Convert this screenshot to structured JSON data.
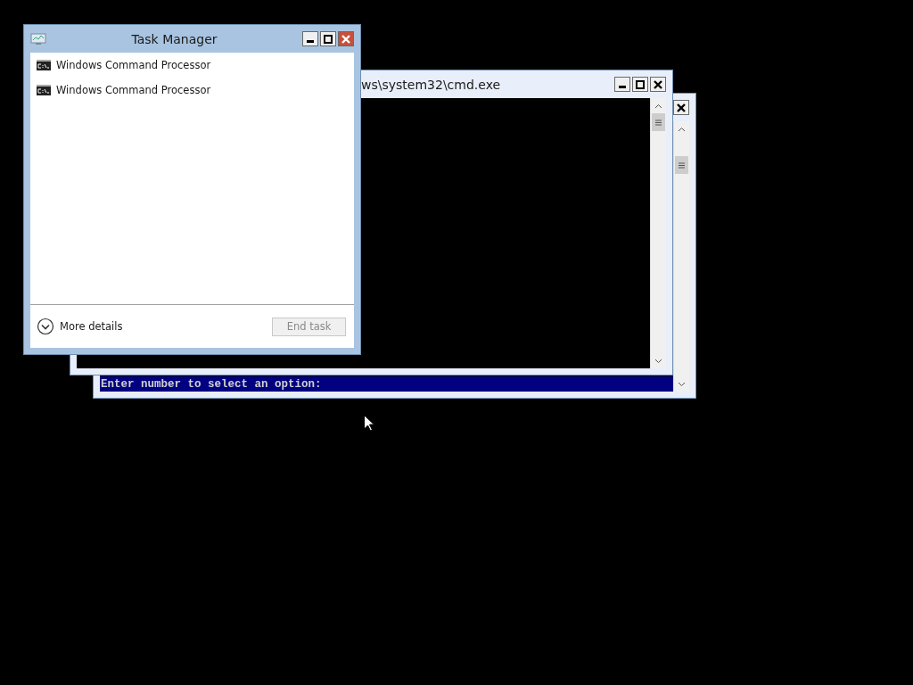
{
  "console_window": {
    "title": "ws\\system32\\cmd.exe"
  },
  "prompt_window": {
    "highlighted_line": "Enter number to select an option:"
  },
  "task_manager": {
    "title": "Task Manager",
    "processes": [
      {
        "name": "Windows Command Processor"
      },
      {
        "name": "Windows Command Processor"
      }
    ],
    "more_details": {
      "label": "More details",
      "expanded": false
    },
    "end_task": {
      "label": "End task",
      "disabled": true
    }
  }
}
